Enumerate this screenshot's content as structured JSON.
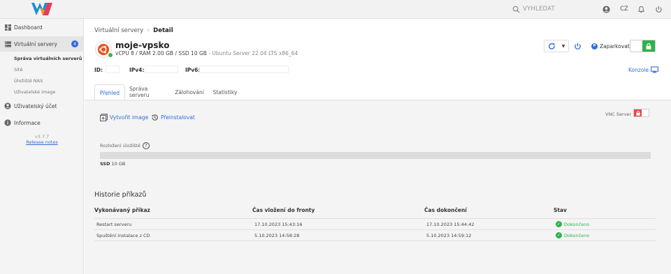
{
  "topbar": {
    "search_placeholder": "VYHLEDAT",
    "language": "CZ"
  },
  "sidebar": {
    "items": [
      {
        "label": "Dashboard",
        "icon": "dashboard-icon"
      },
      {
        "label": "Virtuální servery",
        "icon": "servers-icon",
        "badge": "4"
      },
      {
        "label": "Uživatelský účet",
        "icon": "user-icon"
      },
      {
        "label": "Informace",
        "icon": "info-icon"
      }
    ],
    "subitems": [
      "Správa virtuálních serverů",
      "Sítě",
      "Úložiště NAS",
      "Uživatelské image"
    ],
    "version": "v3.7.7",
    "release_notes": "Release notes"
  },
  "breadcrumb": {
    "parent": "Virtuální servery",
    "current": "Detail"
  },
  "server": {
    "name": "moje-vpsko",
    "specs": "vCPU 8 / RAM 2.00 GB / SSD 10 GB",
    "os": " - Ubuntu Server 22.04 LTS x86_64",
    "status_color": "#3cb44b",
    "id_label": "ID:",
    "ipv4_label": "IPv4:",
    "ipv6_label": "IPv6:"
  },
  "controls": {
    "lock_label": "Zaparkovat",
    "console_label": "Konzole"
  },
  "tabs": [
    "Přehled",
    "Správa serveru",
    "Zálohování",
    "Statistiky"
  ],
  "overview": {
    "create_image": "Vytvořit image",
    "reinstall": "Přeinstalovat",
    "vnc_label": "VNC Server",
    "storage_label": "Rozložení úložiště",
    "storage_type": "SSD",
    "storage_size": "10 GB",
    "storage_used_fraction": 0.0
  },
  "history": {
    "title": "Historie příkazů",
    "headers": [
      "Vykonávaný příkaz",
      "Čas vložení do fronty",
      "Čas dokončení",
      "Stav"
    ],
    "rows": [
      {
        "command": "Restart serveru",
        "queued": "17.10.2023 15:43:16",
        "finished": "17.10.2023 15:44:42",
        "status": "Dokončeno"
      },
      {
        "command": "Spuštění instalace z CD",
        "queued": "5.10.2023 14:58:28",
        "finished": "5.10.2023 14:59:12",
        "status": "Dokončeno"
      }
    ]
  },
  "colors": {
    "accent": "#2f6dd7",
    "success": "#2db34a",
    "danger": "#e14b4b"
  }
}
